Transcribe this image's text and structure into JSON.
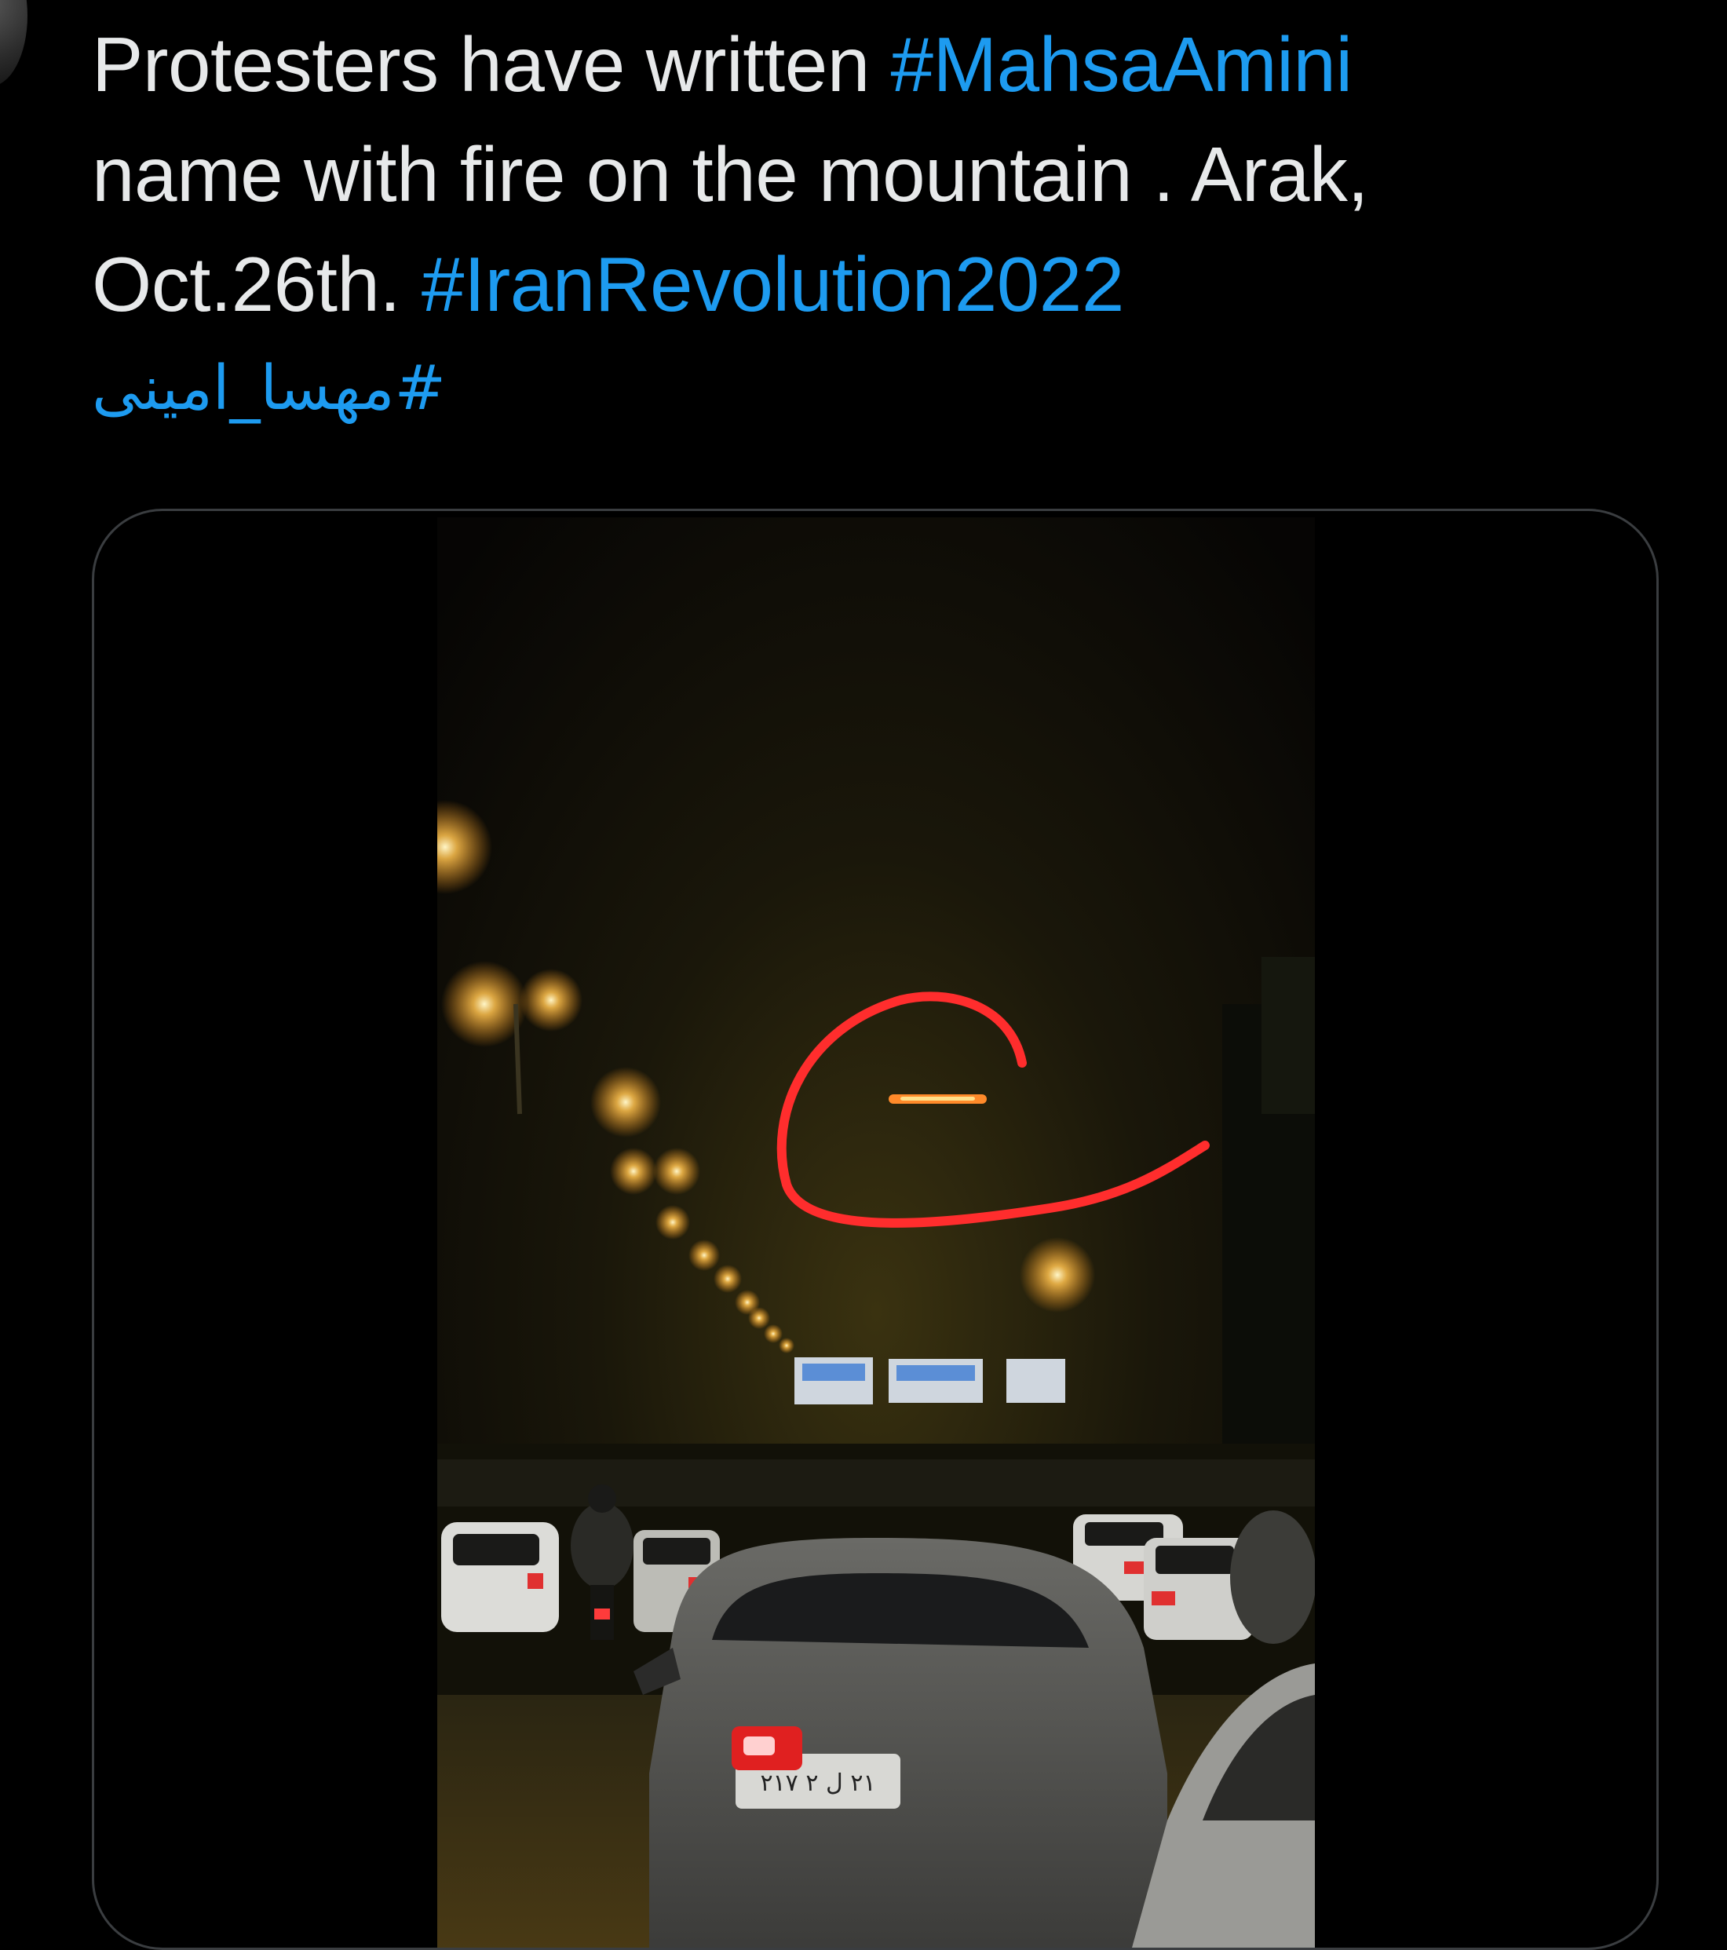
{
  "tweet": {
    "text_line_1": "Protesters have written ",
    "hashtag_1": "#MahsaAmini",
    "text_line_2": "name with fire on the mountain . Arak,",
    "text_line_3": "Oct.26th. ",
    "hashtag_2": "#IranRevolution2022",
    "hashtag_3": "#مهسا_امینی"
  },
  "media": {
    "kind": "video",
    "license_plate_text": "٢١ ل ٢ ٢١٧",
    "annotation_color": "#ff2d2d"
  },
  "colors": {
    "background": "#000000",
    "text": "#e7e9ea",
    "hashtag": "#1d9bf0",
    "card_border": "#3a3d40"
  }
}
